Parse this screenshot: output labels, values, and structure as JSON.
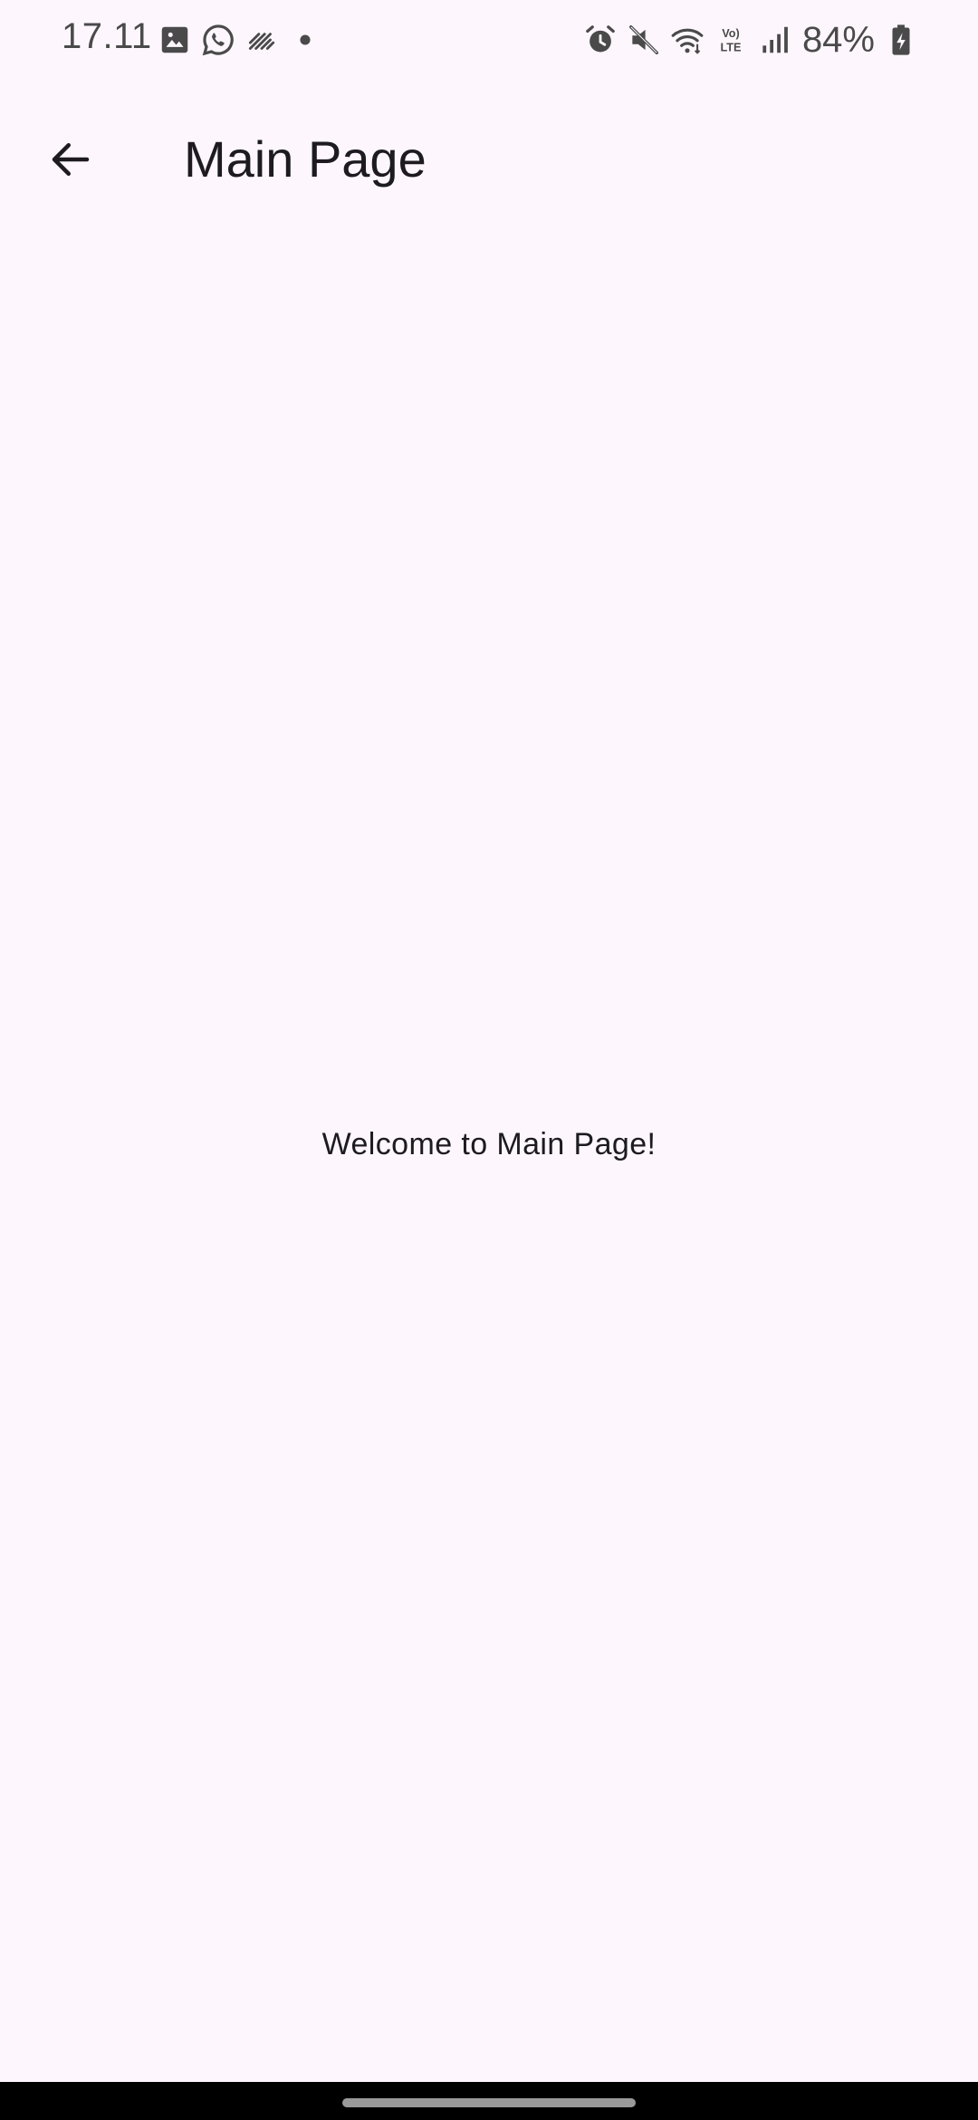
{
  "status_bar": {
    "time": "17.11",
    "battery": "84%",
    "left_icons": [
      "gallery-icon",
      "whatsapp-icon",
      "signal-strength-app-icon",
      "notification-dot-icon"
    ],
    "right_icons": [
      "alarm-icon",
      "mute-icon",
      "wifi-icon",
      "volte-icon",
      "cell-signal-icon",
      "battery-icon"
    ]
  },
  "app_bar": {
    "title": "Main Page",
    "back_icon": "arrow-back-icon"
  },
  "main": {
    "welcome": "Welcome to Main Page!"
  },
  "colors": {
    "background": "#fdf7fd",
    "text": "#1d1b20",
    "status_text": "#4a4a4a"
  }
}
